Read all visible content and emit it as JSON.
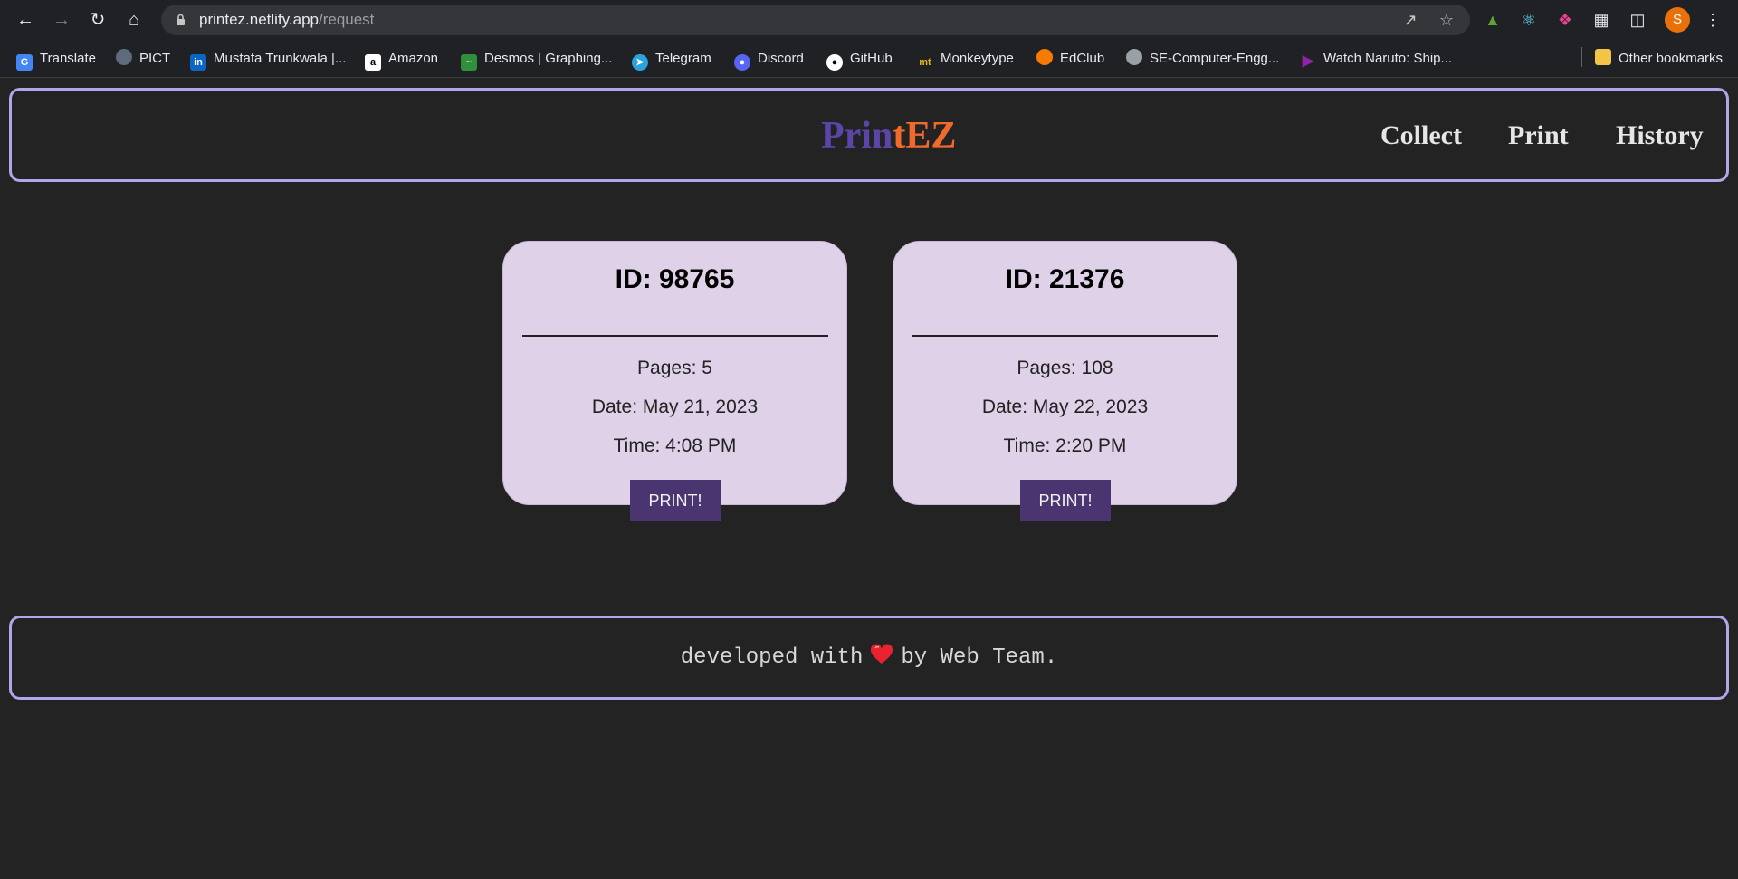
{
  "browser": {
    "url_host": "printez.netlify.app",
    "url_path": "/request",
    "avatar_letter": "S",
    "bookmarks": [
      {
        "label": "Translate",
        "icon": "translate-icon",
        "color": "#4285f4"
      },
      {
        "label": "PICT",
        "icon": "pict-icon",
        "color": "#5f6b7a"
      },
      {
        "label": "Mustafa Trunkwala |...",
        "icon": "linkedin-icon",
        "color": "#0a66c2"
      },
      {
        "label": "Amazon",
        "icon": "amazon-icon",
        "color": "#ffffff"
      },
      {
        "label": "Desmos | Graphing...",
        "icon": "desmos-icon",
        "color": "#2f8f3a"
      },
      {
        "label": "Telegram",
        "icon": "telegram-icon",
        "color": "#2aa3de"
      },
      {
        "label": "Discord",
        "icon": "discord-icon",
        "color": "#5865f2"
      },
      {
        "label": "GitHub",
        "icon": "github-icon",
        "color": "#ffffff"
      },
      {
        "label": "Monkeytype",
        "icon": "monkeytype-icon",
        "color": "#e2b714"
      },
      {
        "label": "EdClub",
        "icon": "edclub-icon",
        "color": "#f57c00"
      },
      {
        "label": "SE-Computer-Engg...",
        "icon": "globe-icon",
        "color": "#9aa0a6"
      },
      {
        "label": "Watch Naruto: Ship...",
        "icon": "play-icon",
        "color": "#8e24aa"
      }
    ],
    "other_bookmarks": "Other bookmarks"
  },
  "header": {
    "logo_part1": "Prin",
    "logo_part2": "tEZ",
    "nav": [
      "Collect",
      "Print",
      "History"
    ]
  },
  "requests": [
    {
      "id": "ID: 98765",
      "pages": "Pages: 5",
      "date": "Date: May 21, 2023",
      "time": "Time: 4:08 PM",
      "button": "PRINT!"
    },
    {
      "id": "ID: 21376",
      "pages": "Pages: 108",
      "date": "Date: May 22, 2023",
      "time": "Time: 2:20 PM",
      "button": "PRINT!"
    }
  ],
  "footer": {
    "text_before": "developed with",
    "text_after": "by Web Team."
  },
  "colors": {
    "accent_border": "#b3a5e8",
    "logo_purple": "#5b46a8",
    "logo_orange": "#f06a2c",
    "card_bg": "#dfd1e8",
    "button_bg": "#4a3570"
  }
}
